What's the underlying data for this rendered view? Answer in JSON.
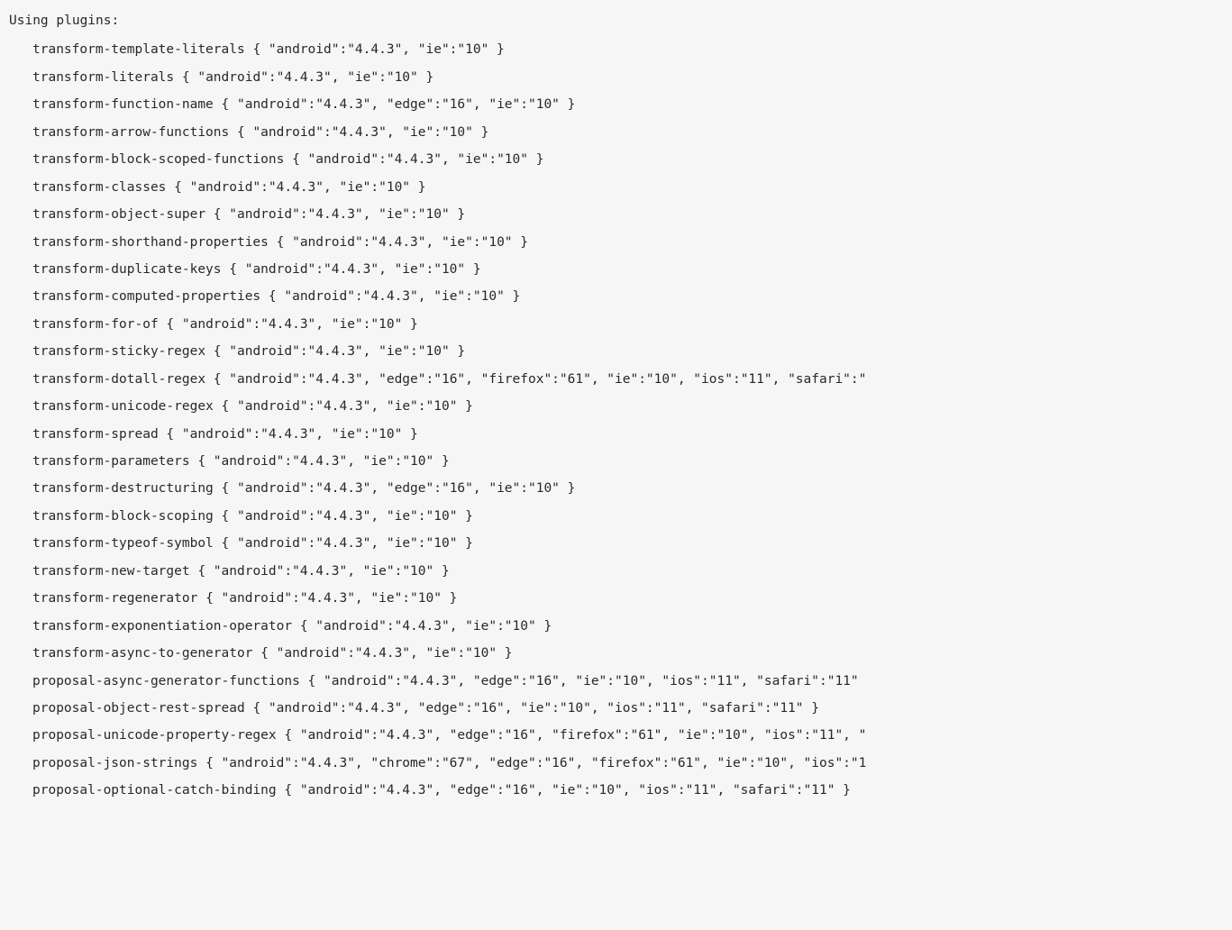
{
  "header": "Using plugins:",
  "plugins": [
    {
      "name": "transform-template-literals",
      "targets": "{ \"android\":\"4.4.3\", \"ie\":\"10\" }"
    },
    {
      "name": "transform-literals",
      "targets": "{ \"android\":\"4.4.3\", \"ie\":\"10\" }"
    },
    {
      "name": "transform-function-name",
      "targets": "{ \"android\":\"4.4.3\", \"edge\":\"16\", \"ie\":\"10\" }"
    },
    {
      "name": "transform-arrow-functions",
      "targets": "{ \"android\":\"4.4.3\", \"ie\":\"10\" }"
    },
    {
      "name": "transform-block-scoped-functions",
      "targets": "{ \"android\":\"4.4.3\", \"ie\":\"10\" }"
    },
    {
      "name": "transform-classes",
      "targets": "{ \"android\":\"4.4.3\", \"ie\":\"10\" }"
    },
    {
      "name": "transform-object-super",
      "targets": "{ \"android\":\"4.4.3\", \"ie\":\"10\" }"
    },
    {
      "name": "transform-shorthand-properties",
      "targets": "{ \"android\":\"4.4.3\", \"ie\":\"10\" }"
    },
    {
      "name": "transform-duplicate-keys",
      "targets": "{ \"android\":\"4.4.3\", \"ie\":\"10\" }"
    },
    {
      "name": "transform-computed-properties",
      "targets": "{ \"android\":\"4.4.3\", \"ie\":\"10\" }"
    },
    {
      "name": "transform-for-of",
      "targets": "{ \"android\":\"4.4.3\", \"ie\":\"10\" }"
    },
    {
      "name": "transform-sticky-regex",
      "targets": "{ \"android\":\"4.4.3\", \"ie\":\"10\" }"
    },
    {
      "name": "transform-dotall-regex",
      "targets": "{ \"android\":\"4.4.3\", \"edge\":\"16\", \"firefox\":\"61\", \"ie\":\"10\", \"ios\":\"11\", \"safari\":\""
    },
    {
      "name": "transform-unicode-regex",
      "targets": "{ \"android\":\"4.4.3\", \"ie\":\"10\" }"
    },
    {
      "name": "transform-spread",
      "targets": "{ \"android\":\"4.4.3\", \"ie\":\"10\" }"
    },
    {
      "name": "transform-parameters",
      "targets": "{ \"android\":\"4.4.3\", \"ie\":\"10\" }"
    },
    {
      "name": "transform-destructuring",
      "targets": "{ \"android\":\"4.4.3\", \"edge\":\"16\", \"ie\":\"10\" }"
    },
    {
      "name": "transform-block-scoping",
      "targets": "{ \"android\":\"4.4.3\", \"ie\":\"10\" }"
    },
    {
      "name": "transform-typeof-symbol",
      "targets": "{ \"android\":\"4.4.3\", \"ie\":\"10\" }"
    },
    {
      "name": "transform-new-target",
      "targets": "{ \"android\":\"4.4.3\", \"ie\":\"10\" }"
    },
    {
      "name": "transform-regenerator",
      "targets": "{ \"android\":\"4.4.3\", \"ie\":\"10\" }"
    },
    {
      "name": "transform-exponentiation-operator",
      "targets": "{ \"android\":\"4.4.3\", \"ie\":\"10\" }"
    },
    {
      "name": "transform-async-to-generator",
      "targets": "{ \"android\":\"4.4.3\", \"ie\":\"10\" }"
    },
    {
      "name": "proposal-async-generator-functions",
      "targets": "{ \"android\":\"4.4.3\", \"edge\":\"16\", \"ie\":\"10\", \"ios\":\"11\", \"safari\":\"11\""
    },
    {
      "name": "proposal-object-rest-spread",
      "targets": "{ \"android\":\"4.4.3\", \"edge\":\"16\", \"ie\":\"10\", \"ios\":\"11\", \"safari\":\"11\" }"
    },
    {
      "name": "proposal-unicode-property-regex",
      "targets": "{ \"android\":\"4.4.3\", \"edge\":\"16\", \"firefox\":\"61\", \"ie\":\"10\", \"ios\":\"11\", \""
    },
    {
      "name": "proposal-json-strings",
      "targets": "{ \"android\":\"4.4.3\", \"chrome\":\"67\", \"edge\":\"16\", \"firefox\":\"61\", \"ie\":\"10\", \"ios\":\"1"
    },
    {
      "name": "proposal-optional-catch-binding",
      "targets": "{ \"android\":\"4.4.3\", \"edge\":\"16\", \"ie\":\"10\", \"ios\":\"11\", \"safari\":\"11\" }"
    }
  ]
}
